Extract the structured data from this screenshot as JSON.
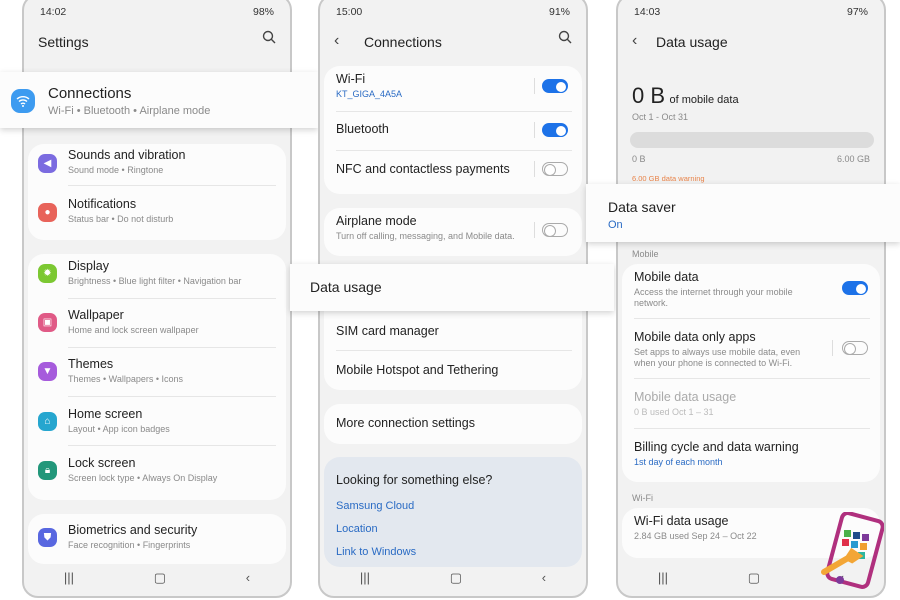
{
  "phone1": {
    "status": {
      "time": "14:02",
      "right": "98%"
    },
    "title": "Settings",
    "connections": {
      "title": "Connections",
      "subtitle": "Wi-Fi  •  Bluetooth  •  Airplane mode"
    },
    "items": [
      {
        "title": "Sounds and vibration",
        "subtitle": "Sound mode  •  Ringtone",
        "color": "#7b6be0"
      },
      {
        "title": "Notifications",
        "subtitle": "Status bar  •  Do not disturb",
        "color": "#e8635a"
      },
      {
        "title": "Display",
        "subtitle": "Brightness  •  Blue light filter  •  Navigation bar",
        "color": "#7cc832"
      },
      {
        "title": "Wallpaper",
        "subtitle": "Home and lock screen wallpaper",
        "color": "#e05a86"
      },
      {
        "title": "Themes",
        "subtitle": "Themes  •  Wallpapers  •  Icons",
        "color": "#a65bdc"
      },
      {
        "title": "Home screen",
        "subtitle": "Layout  •  App icon badges",
        "color": "#26a6cf"
      },
      {
        "title": "Lock screen",
        "subtitle": "Screen lock type  •  Always On Display",
        "color": "#22977a"
      },
      {
        "title": "Biometrics and security",
        "subtitle": "Face recognition  •  Fingerprints",
        "color": "#5867e0"
      }
    ]
  },
  "phone2": {
    "status": {
      "time": "15:00",
      "right": "91%"
    },
    "title": "Connections",
    "wifi": {
      "title": "Wi-Fi",
      "network": "KT_GIGA_4A5A",
      "on": true
    },
    "bluetooth": {
      "title": "Bluetooth",
      "on": true
    },
    "nfc": {
      "title": "NFC and contactless payments",
      "on": false
    },
    "airplane": {
      "title": "Airplane mode",
      "subtitle": "Turn off calling, messaging, and Mobile data.",
      "on": false
    },
    "data_usage": "Data usage",
    "sim": "SIM card manager",
    "hotspot": "Mobile Hotspot and Tethering",
    "more": "More connection settings",
    "looking": {
      "title": "Looking for something else?",
      "links": [
        "Samsung Cloud",
        "Location",
        "Link to Windows"
      ]
    }
  },
  "phone3": {
    "status": {
      "time": "14:03",
      "right": "97%"
    },
    "title": "Data usage",
    "amount": "0 B",
    "amount_suffix": "of mobile data",
    "period": "Oct 1 - Oct 31",
    "bar_min": "0 B",
    "bar_max": "6.00 GB",
    "usage_fraction": 0,
    "warning": "6.00 GB data warning",
    "data_saver": {
      "title": "Data saver",
      "status": "On"
    },
    "mobile_section": "Mobile",
    "mobile_data": {
      "title": "Mobile data",
      "subtitle": "Access the internet through your mobile network.",
      "on": true
    },
    "only_apps": {
      "title": "Mobile data only apps",
      "subtitle": "Set apps to always use mobile data, even when your phone is connected to Wi-Fi.",
      "on": false
    },
    "mobile_usage": {
      "title": "Mobile data usage",
      "subtitle": "0 B used Oct 1 – 31"
    },
    "billing": {
      "title": "Billing cycle and data warning",
      "subtitle": "1st day of each month"
    },
    "wifi_section": "Wi-Fi",
    "wifi_usage": {
      "title": "Wi-Fi data usage",
      "subtitle": "2.84 GB used Sep 24 – Oct 22"
    }
  },
  "colors": {
    "accent": "#1d72e8",
    "link": "#2a6bc4",
    "warning": "#e8844a"
  }
}
